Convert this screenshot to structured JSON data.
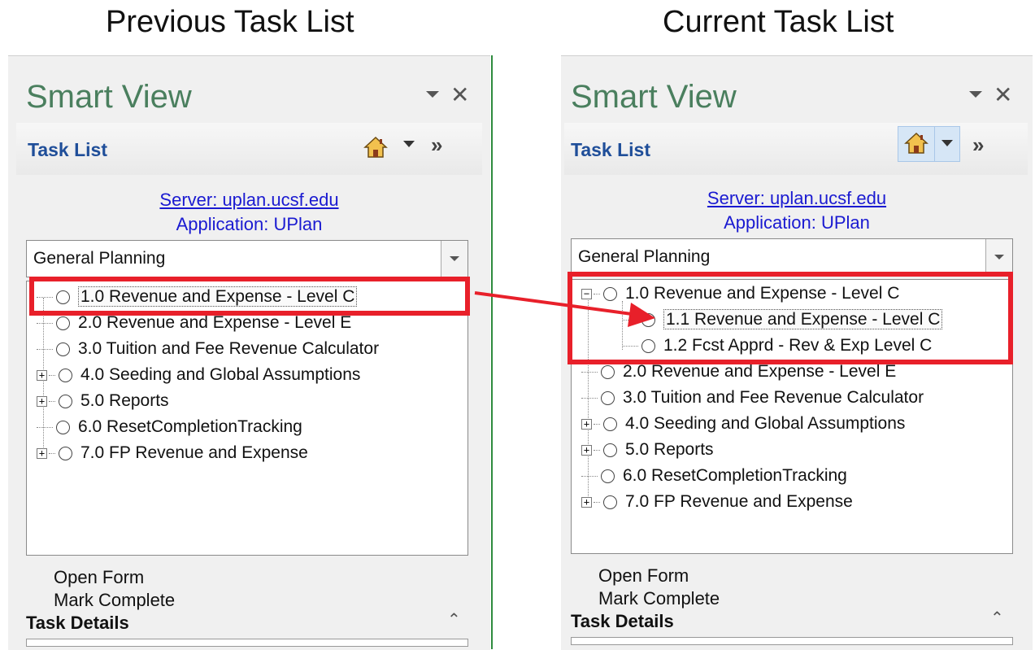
{
  "captions": {
    "previous": "Previous Task List",
    "current": "Current Task List"
  },
  "colors": {
    "title_green": "#4a7f5e",
    "link_blue": "#1a1ad1",
    "highlight_red": "#e8202a",
    "divider_green": "#2e8b3e"
  },
  "icons": {
    "home": "home-icon",
    "dropdown": "chevron-down-icon",
    "more": "double-chevron-right-icon",
    "close": "close-icon",
    "collapse": "double-chevron-up-icon"
  },
  "previous_panel": {
    "title": "Smart View",
    "close_glyph": "✕",
    "header_label": "Task List",
    "more_glyph": "»",
    "server": "Server: uplan.ucsf.edu",
    "application": "Application: UPlan",
    "combo_value": "General Planning",
    "tree": [
      {
        "label": "1.0 Revenue and Expense - Level C",
        "expander": "",
        "selected": true
      },
      {
        "label": "2.0 Revenue and Expense - Level E",
        "expander": ""
      },
      {
        "label": "3.0 Tuition and Fee Revenue Calculator",
        "expander": ""
      },
      {
        "label": "4.0 Seeding and Global Assumptions",
        "expander": "+"
      },
      {
        "label": "5.0 Reports",
        "expander": "+"
      },
      {
        "label": "6.0 ResetCompletionTracking",
        "expander": ""
      },
      {
        "label": "7.0 FP Revenue and Expense",
        "expander": "+"
      }
    ],
    "actions": [
      "Open Form",
      "Mark Complete"
    ],
    "details_label": "Task Details",
    "collapse_glyph": "⌃"
  },
  "current_panel": {
    "title": "Smart View",
    "close_glyph": "✕",
    "header_label": "Task List",
    "more_glyph": "»",
    "server": "Server: uplan.ucsf.edu",
    "application": "Application: UPlan",
    "combo_value": "General Planning",
    "tree": [
      {
        "label": "1.0 Revenue and Expense - Level C",
        "expander": "−"
      },
      {
        "label": "1.1 Revenue and Expense - Level C",
        "expander": "",
        "child": true,
        "selected": true
      },
      {
        "label": "1.2 Fcst Apprd - Rev & Exp Level C",
        "expander": "",
        "child": true
      },
      {
        "label": "2.0 Revenue and Expense - Level E",
        "expander": ""
      },
      {
        "label": "3.0 Tuition and Fee Revenue Calculator",
        "expander": ""
      },
      {
        "label": "4.0 Seeding and Global Assumptions",
        "expander": "+"
      },
      {
        "label": "5.0 Reports",
        "expander": "+"
      },
      {
        "label": "6.0 ResetCompletionTracking",
        "expander": ""
      },
      {
        "label": "7.0 FP Revenue and Expense",
        "expander": "+"
      }
    ],
    "actions": [
      "Open Form",
      "Mark Complete"
    ],
    "details_label": "Task Details",
    "collapse_glyph": "⌃"
  }
}
